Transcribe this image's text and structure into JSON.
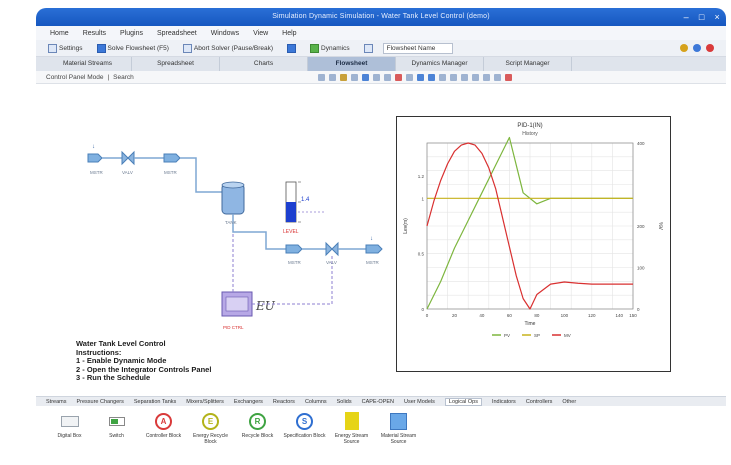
{
  "window": {
    "title": "Simulation Dynamic Simulation - Water Tank Level Control (demo)"
  },
  "menu": [
    "Home",
    "Results",
    "Plugins",
    "Spreadsheet",
    "Windows",
    "View",
    "Help"
  ],
  "toolbar": {
    "settings": "Settings",
    "solve_flowsheet": "Solve Flowsheet (F5)",
    "abort_solver": "Abort Solver (Pause/Break)",
    "dynamics": "Dynamics",
    "flowsheet_name": "Flowsheet Name"
  },
  "tabs": [
    "Material Streams",
    "Spreadsheet",
    "Charts",
    "Flowsheet",
    "Dynamics Manager",
    "Script Manager"
  ],
  "active_tab": "Flowsheet",
  "subtoolbar": {
    "mode": "Control Panel Mode",
    "search": "Search"
  },
  "flowsheet": {
    "stream_labels": [
      "MSTR",
      "VALV",
      "MSTR",
      "TANK",
      "MSTR",
      "VALV",
      "MSTR",
      "PID CTRL"
    ],
    "level_indicator_value": "1.4",
    "level_indicator_label": "LEVEL",
    "pid_symbol": "EU",
    "instructions": [
      "Water Tank Level Control",
      "Instructions:",
      "1 - Enable Dynamic Mode",
      "2 - Open the Integrator Controls Panel",
      "3 - Run the Schedule"
    ]
  },
  "palette": {
    "tabs": [
      "Streams",
      "Pressure Changers",
      "Separation Tanks",
      "Mixers/Splitters",
      "Exchangers",
      "Reactors",
      "Columns",
      "Solids",
      "CAPE-OPEN",
      "User Models",
      "Logical Ops",
      "Indicators",
      "Controllers",
      "Other"
    ],
    "active_tab": "Logical Ops",
    "items": [
      {
        "label": "Digital Box",
        "icon": "display-box-icon",
        "glyph": "",
        "color": "#9aa3ad"
      },
      {
        "label": "Switch",
        "icon": "switch-icon",
        "glyph": "",
        "color": "#3fa342"
      },
      {
        "label": "Controller Block",
        "icon": "controller-block-icon",
        "glyph": "A",
        "color": "#d93a3a"
      },
      {
        "label": "Energy Recycle Block",
        "icon": "energy-recycle-icon",
        "glyph": "E",
        "color": "#b3b31a"
      },
      {
        "label": "Recycle Block",
        "icon": "recycle-block-icon",
        "glyph": "R",
        "color": "#3fa342"
      },
      {
        "label": "Specification Block",
        "icon": "specification-block-icon",
        "glyph": "S",
        "color": "#2f6fd1"
      },
      {
        "label": "Energy Stream Source",
        "icon": "energy-source-icon",
        "glyph": "",
        "color": "#e6d416"
      },
      {
        "label": "Material Stream Source",
        "icon": "material-source-icon",
        "glyph": "",
        "color": "#6aa8e8"
      }
    ]
  },
  "chart_data": {
    "type": "line",
    "title": "PID-1(IN)",
    "subtitle": "History",
    "xlabel": "Time",
    "ylabel_left": "Lev(m)",
    "ylabel_right": "%V",
    "xlim": [
      0,
      150
    ],
    "ylim_left": [
      0,
      1.5
    ],
    "ylim_right": [
      0,
      400
    ],
    "x_ticks": [
      "0",
      "20",
      "40",
      "60",
      "80",
      "100",
      "120",
      "140",
      "150"
    ],
    "y_ticks_left": [
      "0",
      "0.5",
      "1",
      "1.2"
    ],
    "y_ticks_right": [
      "0",
      "100",
      "200",
      "400"
    ],
    "grid": true,
    "legend_position": "bottom",
    "series": [
      {
        "name": "PV",
        "color": "#7db63e",
        "x": [
          0,
          10,
          20,
          30,
          40,
          50,
          60,
          70,
          80,
          90,
          100,
          110,
          120,
          130,
          140,
          150
        ],
        "y": [
          0,
          0.25,
          0.55,
          0.8,
          1.05,
          1.3,
          1.55,
          1.05,
          0.95,
          1.0,
          1.0,
          1.0,
          1.0,
          1.0,
          1.0,
          1.0
        ]
      },
      {
        "name": "SP",
        "color": "#c7b21c",
        "x": [
          0,
          150
        ],
        "y": [
          1.0,
          1.0
        ]
      },
      {
        "name": "MV",
        "color": "#d93030",
        "x": [
          0,
          5,
          10,
          15,
          20,
          25,
          30,
          35,
          40,
          45,
          50,
          55,
          60,
          65,
          70,
          75,
          80,
          90,
          100,
          110,
          120,
          130,
          140,
          150
        ],
        "y": [
          200,
          260,
          310,
          350,
          380,
          395,
          400,
          395,
          375,
          340,
          290,
          220,
          150,
          80,
          25,
          0,
          35,
          60,
          65,
          62,
          60,
          60,
          60,
          60
        ]
      }
    ]
  }
}
